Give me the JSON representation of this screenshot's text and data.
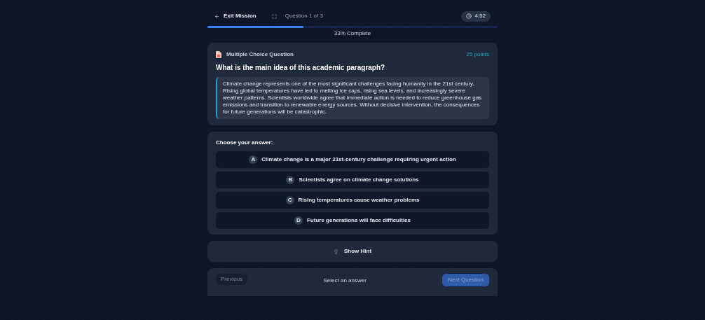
{
  "header": {
    "exit": "Exit Mission",
    "counter": "Question 1 of 3",
    "timer": "4:52"
  },
  "progress": {
    "level": 0.33,
    "label": "33% Complete"
  },
  "question": {
    "type": "Multiple Choice Question",
    "points": "25 points",
    "title": "What is the main idea of this academic paragraph?",
    "passage": "Climate change represents one of the most significant challenges facing humanity in the 21st century. Rising global temperatures have led to melting ice caps, rising sea levels, and increasingly severe weather patterns. Scientists worldwide agree that immediate action is needed to reduce greenhouse gas emissions and transition to renewable energy sources. Without decisive intervention, the consequences for future generations will be catastrophic."
  },
  "answers": {
    "prompt": "Choose your answer:",
    "options": [
      {
        "letter": "A",
        "text": "Climate change is a major 21st-century challenge requiring urgent action",
        "selected": false
      },
      {
        "letter": "B",
        "text": "Scientists agree on climate change solutions",
        "selected": false
      },
      {
        "letter": "C",
        "text": "Rising temperatures cause weather problems",
        "selected": false
      },
      {
        "letter": "D",
        "text": "Future generations will face difficulties",
        "selected": false
      }
    ]
  },
  "hint": {
    "label": "Show Hint"
  },
  "footer": {
    "previous": {
      "label": "Previous",
      "disabled": true
    },
    "status": "Select an answer",
    "next": {
      "label": "Next Question",
      "disabled": true
    }
  }
}
